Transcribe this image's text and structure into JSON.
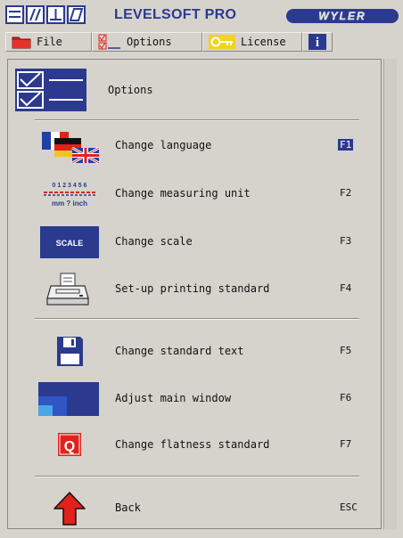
{
  "title_bar": {
    "app_title": "LEVELSOFT PRO",
    "brand": "WYLER"
  },
  "menu": {
    "file": "File",
    "options": "Options",
    "license": "License",
    "info": "i"
  },
  "panel": {
    "title": "Options",
    "items": [
      {
        "label": "Change language",
        "key": "F1",
        "icon": "flags-icon"
      },
      {
        "label": "Change measuring unit",
        "key": "F2",
        "icon": "ruler-units-icon"
      },
      {
        "label": "Change scale",
        "key": "F3",
        "icon": "scale-icon"
      },
      {
        "label": "Set-up printing standard",
        "key": "F4",
        "icon": "printer-icon"
      },
      {
        "label": "Change standard text",
        "key": "F5",
        "icon": "floppy-disk-icon"
      },
      {
        "label": "Adjust main window",
        "key": "F6",
        "icon": "window-icon"
      },
      {
        "label": "Change flatness standard",
        "key": "F7",
        "icon": "q-icon"
      },
      {
        "label": "Back",
        "key": "ESC",
        "icon": "back-arrow-icon"
      }
    ],
    "units_icon": {
      "digits": "0 1 2 3 4 5 6",
      "text": "mm ? inch"
    },
    "scale_icon_text": "SCALE",
    "q_icon_text": "Q"
  },
  "colors": {
    "accent": "#2b3a8f",
    "background": "#d6d3cc",
    "red": "#e1211b"
  }
}
